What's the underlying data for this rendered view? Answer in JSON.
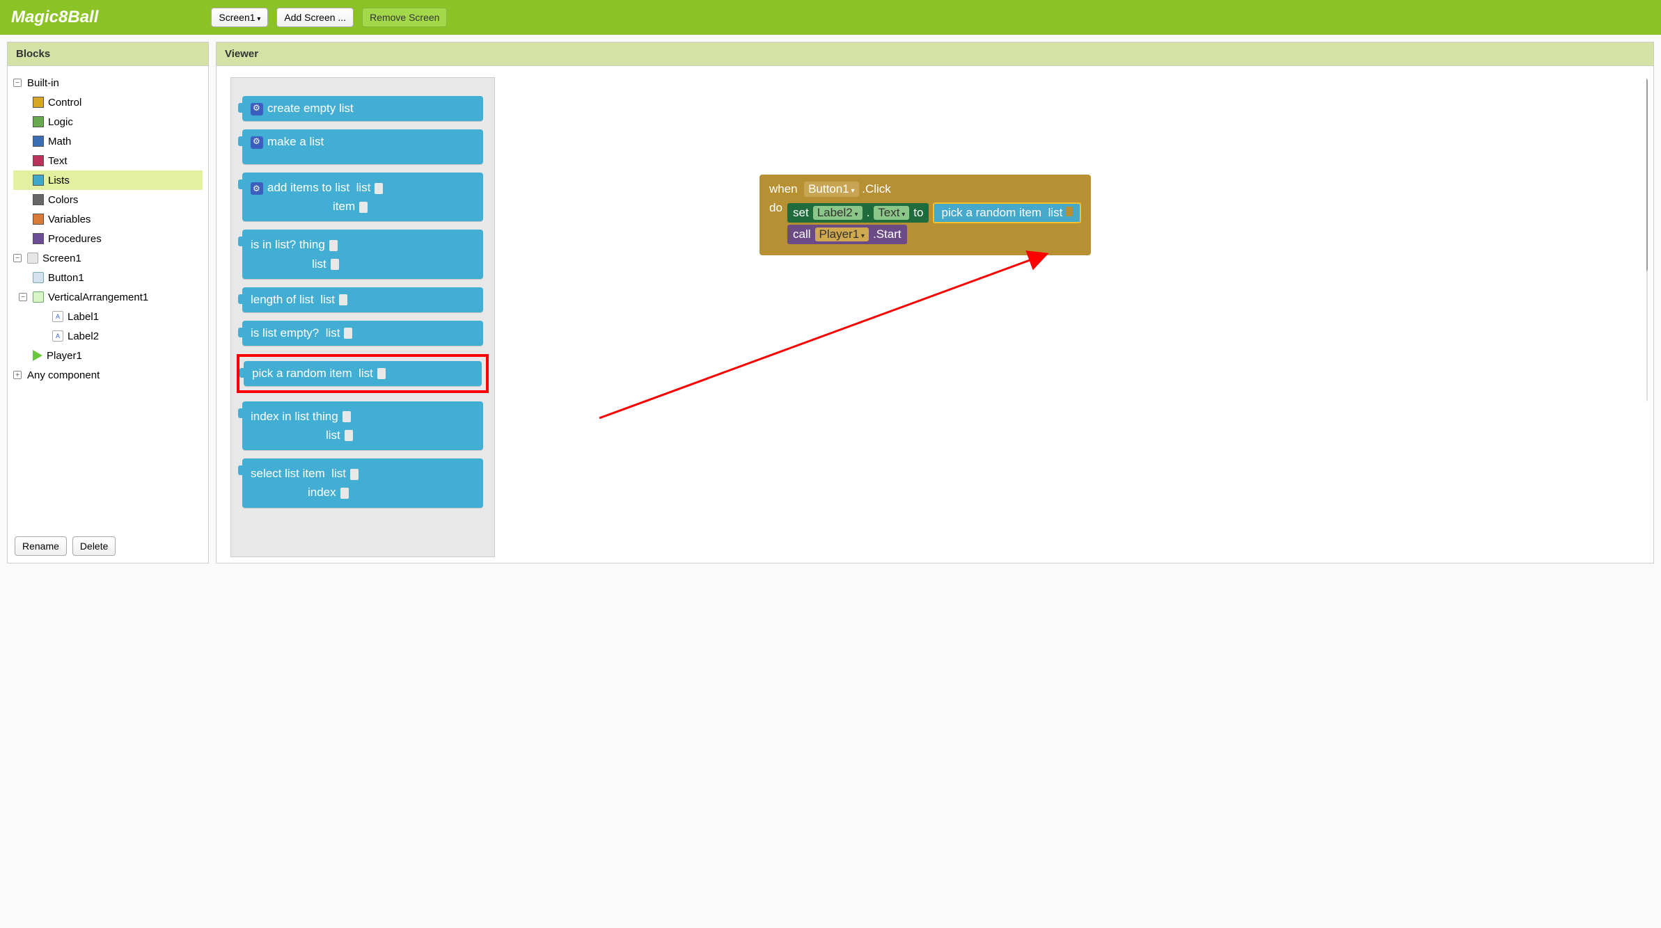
{
  "topbar": {
    "title": "Magic8Ball",
    "screen_button": "Screen1",
    "add_screen": "Add Screen ...",
    "remove_screen": "Remove Screen"
  },
  "panels": {
    "blocks": "Blocks",
    "viewer": "Viewer"
  },
  "tree": {
    "builtin": "Built-in",
    "control": "Control",
    "logic": "Logic",
    "math": "Math",
    "text": "Text",
    "lists": "Lists",
    "colors": "Colors",
    "variables": "Variables",
    "procedures": "Procedures",
    "screen1": "Screen1",
    "button1": "Button1",
    "vert": "VerticalArrangement1",
    "label1": "Label1",
    "label2": "Label2",
    "player1": "Player1",
    "any": "Any component",
    "rename": "Rename",
    "delete": "Delete",
    "a_glyph": "A"
  },
  "palette": {
    "create_empty": "create empty list",
    "make_a_list": "make a list",
    "add_items": "add items to list",
    "list": "list",
    "item": "item",
    "is_in_list": "is in list?",
    "thing": "thing",
    "length_of_list": "length of list",
    "is_list_empty": "is list empty?",
    "pick_random": "pick a random item",
    "index_in_list": "index in list",
    "select_item": "select list item",
    "index": "index"
  },
  "canvas": {
    "when": "when",
    "button1": "Button1",
    "click": ".Click",
    "do": "do",
    "set": "set",
    "label2": "Label2",
    "text": "Text",
    "to": "to",
    "pick_random": "pick a random item",
    "list": "list",
    "call": "call",
    "player1": "Player1",
    "start": ".Start"
  }
}
